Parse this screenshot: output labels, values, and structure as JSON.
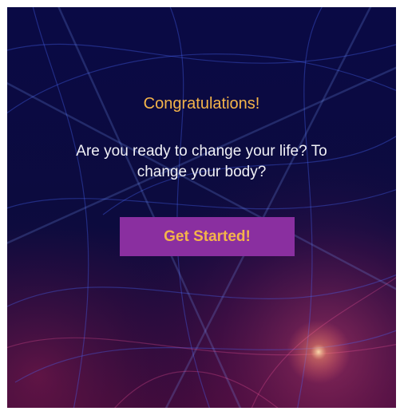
{
  "screen": {
    "title": "Congratulations!",
    "message": "Are you ready to change your life? To change your body?",
    "cta_label": "Get Started!"
  },
  "colors": {
    "title": "#f4b44a",
    "message": "#f1f1f6",
    "button_background": "#8a2fa0",
    "button_text": "#f4b44a",
    "background_base": "#0b0b44"
  },
  "background": {
    "description_icon": "abstract-light-streaks"
  }
}
